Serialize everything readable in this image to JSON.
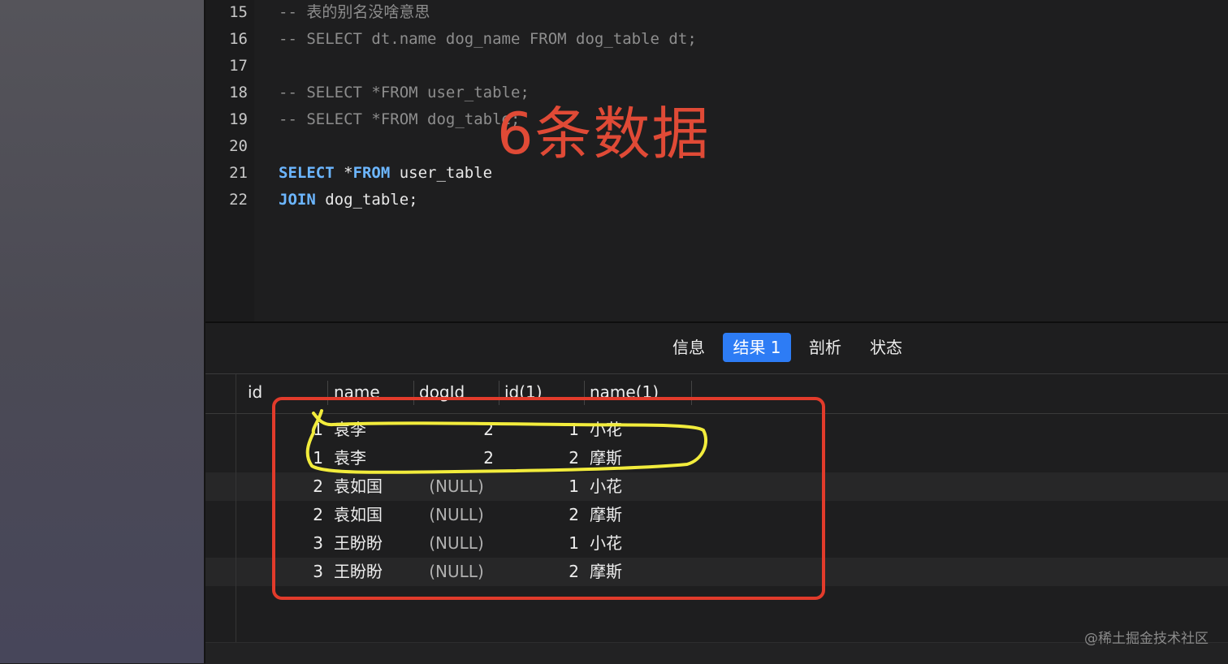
{
  "editor": {
    "lines": [
      {
        "no": "15",
        "text": "-- 表的别名没啥意思",
        "type": "comment"
      },
      {
        "no": "16",
        "text": "-- SELECT dt.name dog_name FROM dog_table dt;",
        "type": "comment"
      },
      {
        "no": "17",
        "text": "",
        "type": "plain"
      },
      {
        "no": "18",
        "text": "-- SELECT *FROM user_table;",
        "type": "comment"
      },
      {
        "no": "19",
        "text": "-- SELECT *FROM dog_table;",
        "type": "comment"
      },
      {
        "no": "20",
        "text": "",
        "type": "plain"
      },
      {
        "no": "21",
        "parts": [
          {
            "t": "SELECT",
            "kw": true
          },
          {
            "t": " *",
            "kw": false
          },
          {
            "t": "FROM",
            "kw": true
          },
          {
            "t": " user_table",
            "kw": false
          }
        ],
        "type": "code"
      },
      {
        "no": "22",
        "parts": [
          {
            "t": "JOIN",
            "kw": true
          },
          {
            "t": " dog_table;",
            "kw": false
          }
        ],
        "type": "code"
      }
    ],
    "colors": {
      "keyword": "#6cb6ff",
      "comment": "#8d8d8d",
      "text": "#e8e8e8"
    }
  },
  "annotation": {
    "label": "6条数据",
    "label_color": "#e04a36",
    "box_color": "#e23b2b",
    "highlight_color": "#f2ec3c"
  },
  "tabs": [
    {
      "label": "信息",
      "active": false
    },
    {
      "label": "结果 1",
      "active": true
    },
    {
      "label": "剖析",
      "active": false
    },
    {
      "label": "状态",
      "active": false
    }
  ],
  "accent_color": "#2d7cf5",
  "result_grid": {
    "columns": [
      "id",
      "name",
      "dogId",
      "id(1)",
      "name(1)"
    ],
    "rows": [
      [
        "1",
        "袁李",
        "2",
        "1",
        "小花"
      ],
      [
        "1",
        "袁李",
        "2",
        "2",
        "摩斯"
      ],
      [
        "2",
        "袁如国",
        "(NULL)",
        "1",
        "小花"
      ],
      [
        "2",
        "袁如国",
        "(NULL)",
        "2",
        "摩斯"
      ],
      [
        "3",
        "王盼盼",
        "(NULL)",
        "1",
        "小花"
      ],
      [
        "3",
        "王盼盼",
        "(NULL)",
        "2",
        "摩斯"
      ]
    ]
  },
  "watermark": "@稀土掘金技术社区"
}
